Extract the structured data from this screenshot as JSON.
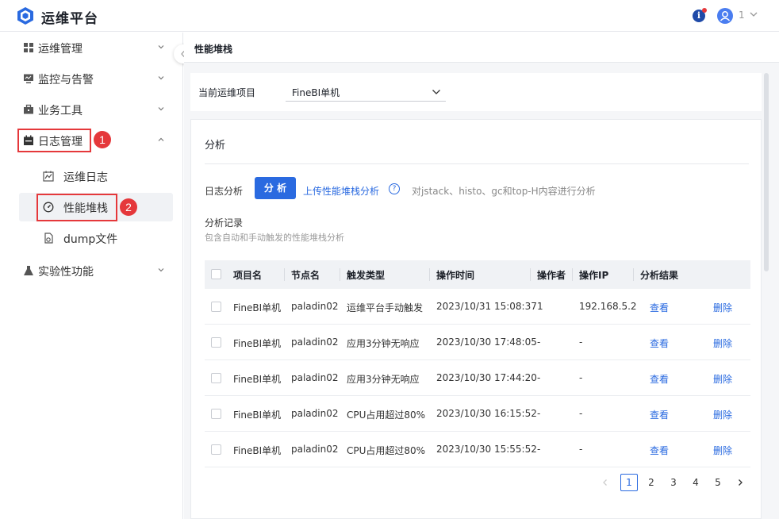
{
  "header": {
    "app_title": "运维平台",
    "user_name": "1"
  },
  "sidebar": {
    "items": [
      {
        "label": "运维管理",
        "icon": "grid-icon"
      },
      {
        "label": "监控与告警",
        "icon": "monitor-icon"
      },
      {
        "label": "业务工具",
        "icon": "toolbox-icon"
      },
      {
        "label": "日志管理",
        "icon": "calendar-icon",
        "expanded": true
      },
      {
        "label": "实验性功能",
        "icon": "flask-icon"
      }
    ],
    "sub_items": [
      {
        "label": "运维日志",
        "icon": "chart-icon"
      },
      {
        "label": "性能堆栈",
        "icon": "gauge-icon",
        "active": true
      },
      {
        "label": "dump文件",
        "icon": "file-icon"
      }
    ],
    "annotations": {
      "first": "1",
      "second": "2"
    }
  },
  "breadcrumb": "性能堆栈",
  "project": {
    "label": "当前运维项目",
    "selected": "FineBI单机"
  },
  "analysis": {
    "section_title": "分析",
    "log_label": "日志分析",
    "analyze_button": "分 析",
    "upload_link": "上传性能堆栈分析",
    "hint": "对jstack、histo、gc和top-H内容进行分析",
    "records_title": "分析记录",
    "records_desc": "包含自动和手动触发的性能堆栈分析"
  },
  "table": {
    "columns": [
      "项目名",
      "节点名",
      "触发类型",
      "操作时间",
      "操作者",
      "操作IP",
      "分析结果"
    ],
    "rows": [
      {
        "project": "FineBI单机",
        "node": "paladin02",
        "trigger": "运维平台手动触发",
        "time": "2023/10/31 15:08:37",
        "operator": "1",
        "ip": "192.168.5.2",
        "view": "查看",
        "delete": "删除"
      },
      {
        "project": "FineBI单机",
        "node": "paladin02",
        "trigger": "应用3分钟无响应",
        "time": "2023/10/30 17:48:05",
        "operator": "-",
        "ip": "-",
        "view": "查看",
        "delete": "删除"
      },
      {
        "project": "FineBI单机",
        "node": "paladin02",
        "trigger": "应用3分钟无响应",
        "time": "2023/10/30 17:44:20",
        "operator": "-",
        "ip": "-",
        "view": "查看",
        "delete": "删除"
      },
      {
        "project": "FineBI单机",
        "node": "paladin02",
        "trigger": "CPU占用超过80%",
        "time": "2023/10/30 16:15:52",
        "operator": "-",
        "ip": "-",
        "view": "查看",
        "delete": "删除"
      },
      {
        "project": "FineBI单机",
        "node": "paladin02",
        "trigger": "CPU占用超过80%",
        "time": "2023/10/30 15:55:52",
        "operator": "-",
        "ip": "-",
        "view": "查看",
        "delete": "删除"
      }
    ]
  },
  "pagination": {
    "pages": [
      "1",
      "2",
      "3",
      "4",
      "5"
    ],
    "current": "1"
  },
  "colors": {
    "accent": "#2a6ae0",
    "highlight": "#e5383b"
  }
}
